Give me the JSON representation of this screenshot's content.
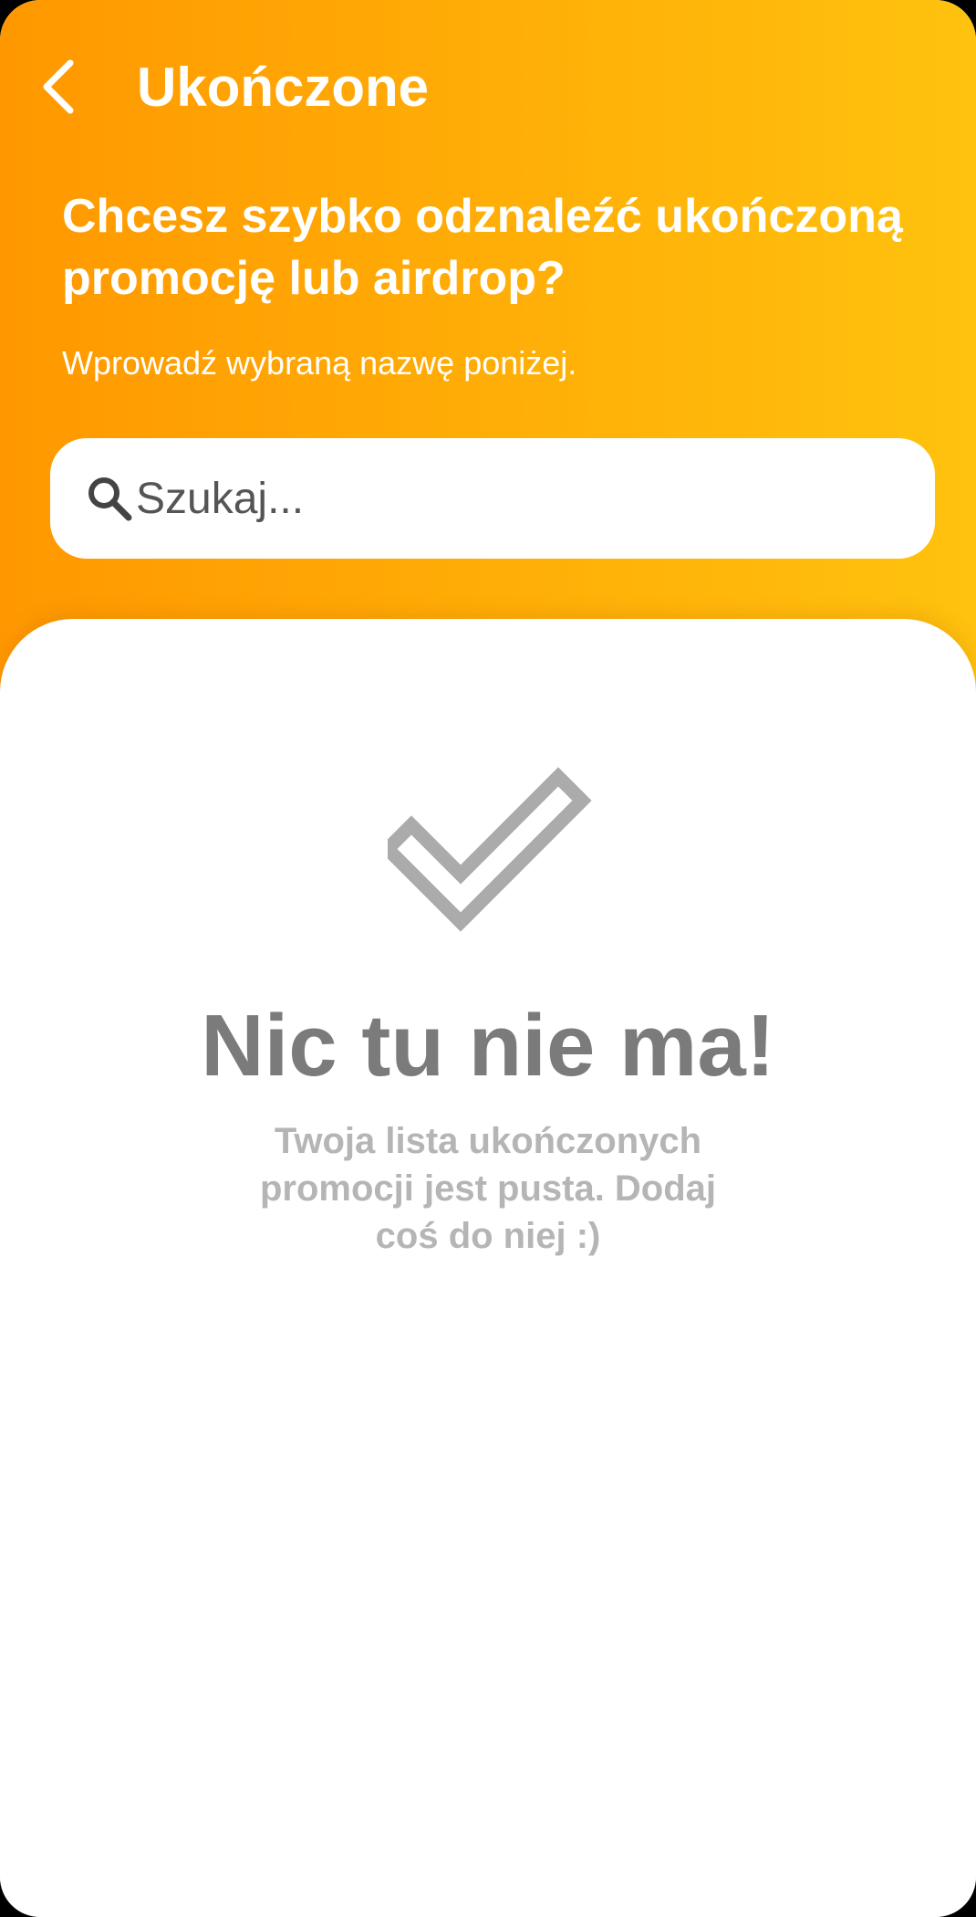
{
  "header": {
    "title": "Ukończone",
    "headline": "Chcesz szybko odznaleźć ukończoną promocję lub airdrop?",
    "subline": "Wprowadź wybraną nazwę poniżej.",
    "gradient_colors": [
      "#ff9800",
      "#ffc20e"
    ],
    "back_icon": "chevron-left-icon"
  },
  "search": {
    "placeholder": "Szukaj...",
    "value": "",
    "icon": "search-icon"
  },
  "empty_state": {
    "icon": "checkmark-icon",
    "title": "Nic tu nie ma!",
    "message": "Twoja lista ukończonych promocji jest pusta. Dodaj coś do niej :)",
    "title_color": "#7b7b7b",
    "message_color": "#b5b5b5"
  }
}
